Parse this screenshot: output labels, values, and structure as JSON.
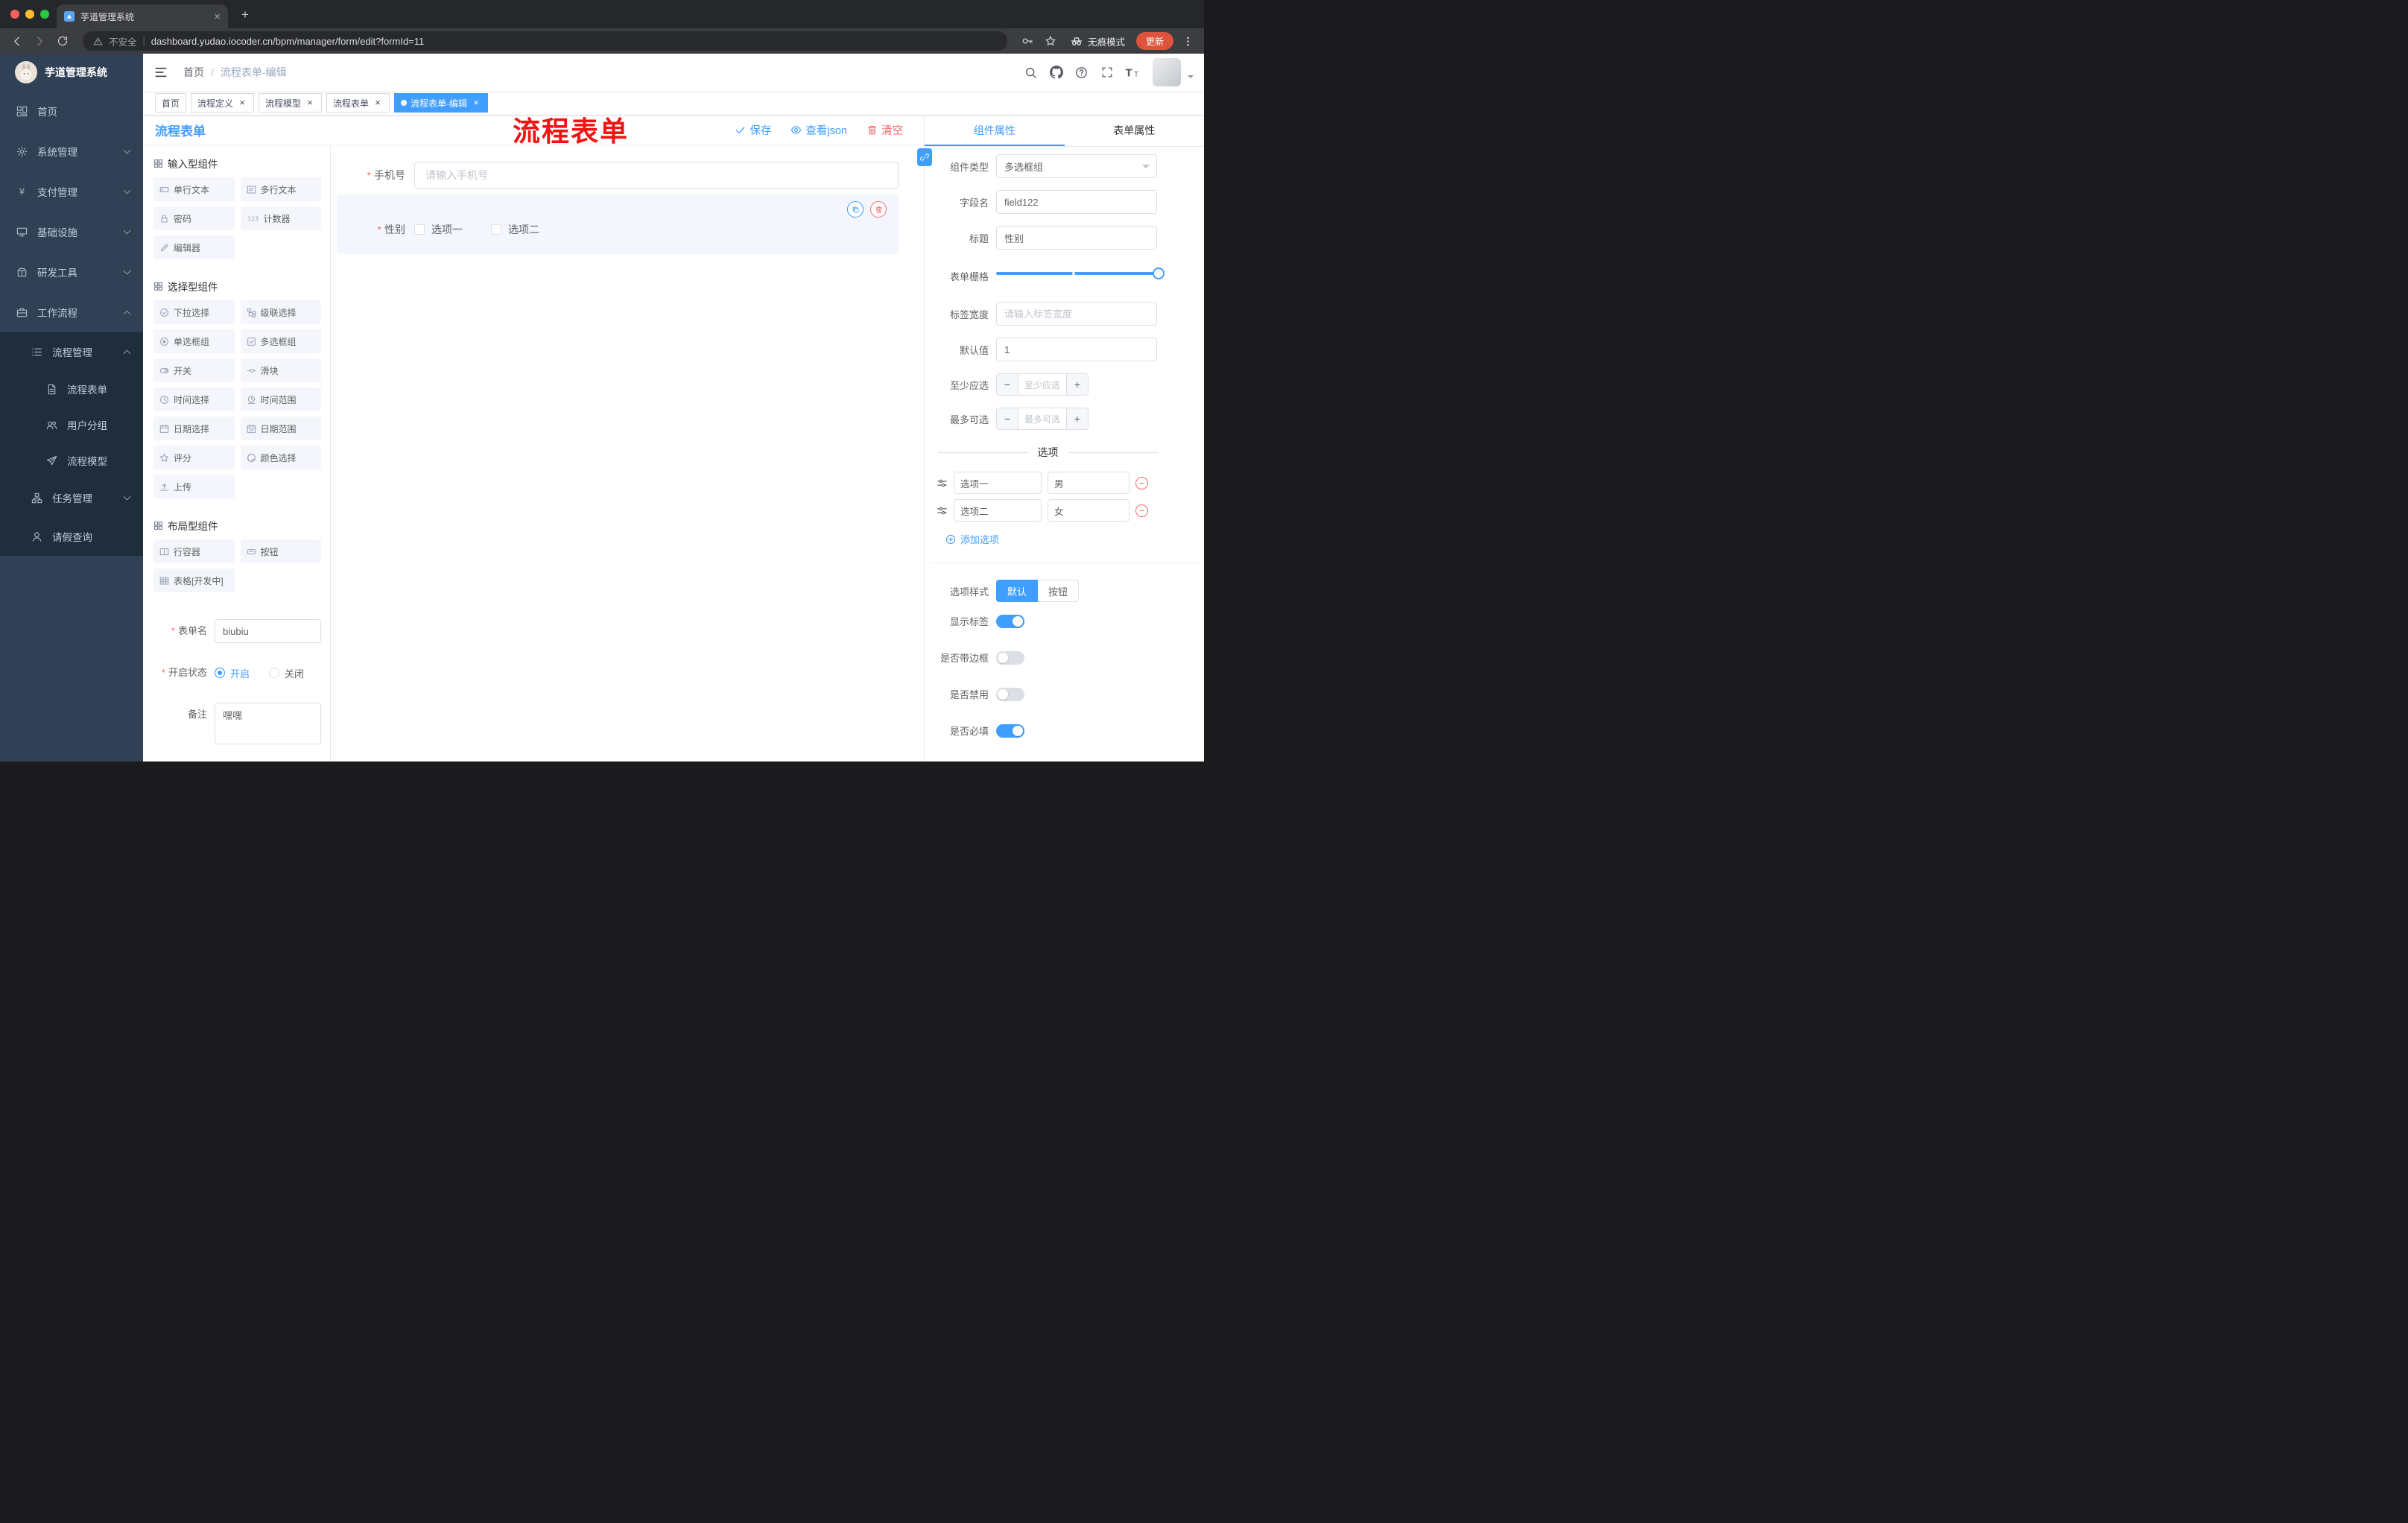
{
  "colors": {
    "accent": "#409eff",
    "danger": "#f56c6c",
    "sidebar": "#304156",
    "sidebar_sub": "#1f2d3d",
    "annotation": "#f21414",
    "update_pill": "#df523c"
  },
  "chrome": {
    "tab_title": "芋道管理系统",
    "security_label": "不安全",
    "url": "dashboard.yudao.iocoder.cn/bpm/manager/form/edit?formId=11",
    "incognito_label": "无痕模式",
    "update_label": "更新"
  },
  "annotation_text": "流程表单",
  "sidebar": {
    "logo_title": "芋道管理系统",
    "menu": [
      {
        "label": "首页",
        "icon": "dashboard"
      },
      {
        "label": "系统管理",
        "icon": "gear",
        "arrow": "down"
      },
      {
        "label": "支付管理",
        "icon": "yen",
        "arrow": "down"
      },
      {
        "label": "基础设施",
        "icon": "infra",
        "arrow": "down"
      },
      {
        "label": "研发工具",
        "icon": "tools",
        "arrow": "down"
      },
      {
        "label": "工作流程",
        "icon": "workflow",
        "arrow": "up"
      }
    ],
    "submenu": [
      {
        "label": "流程管理",
        "icon": "list",
        "arrow": "up",
        "level": 1
      },
      {
        "label": "流程表单",
        "icon": "doc",
        "level": 2
      },
      {
        "label": "用户分组",
        "icon": "users",
        "level": 2
      },
      {
        "label": "流程模型",
        "icon": "send",
        "level": 2
      },
      {
        "label": "任务管理",
        "icon": "tree",
        "arrow": "down",
        "level": 1
      },
      {
        "label": "请假查询",
        "icon": "user",
        "level": 1
      }
    ]
  },
  "header": {
    "breadcrumb": [
      "首页",
      "流程表单-编辑"
    ]
  },
  "tags": [
    {
      "label": "首页",
      "closable": false,
      "active": false
    },
    {
      "label": "流程定义",
      "closable": true,
      "active": false
    },
    {
      "label": "流程模型",
      "closable": true,
      "active": false
    },
    {
      "label": "流程表单",
      "closable": true,
      "active": false
    },
    {
      "label": "流程表单-编辑",
      "closable": true,
      "active": true
    }
  ],
  "designer": {
    "panel_title": "流程表单",
    "actions": {
      "save": "保存",
      "view_json": "查看json",
      "clear": "清空"
    },
    "palette": [
      {
        "title": "输入型组件",
        "items": [
          {
            "label": "单行文本",
            "icon": "input"
          },
          {
            "label": "多行文本",
            "icon": "textarea"
          },
          {
            "label": "密码",
            "icon": "password"
          },
          {
            "label": "计数器",
            "icon": "counter"
          },
          {
            "label": "编辑器",
            "icon": "editor"
          }
        ]
      },
      {
        "title": "选择型组件",
        "items": [
          {
            "label": "下拉选择",
            "icon": "select"
          },
          {
            "label": "级联选择",
            "icon": "cascader"
          },
          {
            "label": "单选框组",
            "icon": "radio"
          },
          {
            "label": "多选框组",
            "icon": "checkbox"
          },
          {
            "label": "开关",
            "icon": "switch"
          },
          {
            "label": "滑块",
            "icon": "slider"
          },
          {
            "label": "时间选择",
            "icon": "time"
          },
          {
            "label": "时间范围",
            "icon": "timerange"
          },
          {
            "label": "日期选择",
            "icon": "date"
          },
          {
            "label": "日期范围",
            "icon": "daterange"
          },
          {
            "label": "评分",
            "icon": "rate"
          },
          {
            "label": "颜色选择",
            "icon": "color"
          },
          {
            "label": "上传",
            "icon": "upload"
          }
        ]
      },
      {
        "title": "布局型组件",
        "items": [
          {
            "label": "行容器",
            "icon": "row"
          },
          {
            "label": "按钮",
            "icon": "button"
          },
          {
            "label": "表格[开发中]",
            "icon": "table"
          }
        ]
      }
    ],
    "meta": {
      "name_label": "表单名",
      "name_value": "biubiu",
      "status_label": "开启状态",
      "status_on": "开启",
      "status_off": "关闭",
      "remark_label": "备注",
      "remark_value": "嘿嘿"
    },
    "canvas": {
      "phone_label": "手机号",
      "phone_placeholder": "请输入手机号",
      "gender_label": "性别",
      "gender_options": [
        "选项一",
        "选项二"
      ]
    }
  },
  "props": {
    "tabs": [
      "组件属性",
      "表单属性"
    ],
    "type_label": "组件类型",
    "type_value": "多选框组",
    "field_label": "字段名",
    "field_value": "field122",
    "title_label": "标题",
    "title_value": "性别",
    "grid_label": "表单栅格",
    "width_label": "标签宽度",
    "width_placeholder": "请输入标签宽度",
    "default_label": "默认值",
    "default_value": "1",
    "min_label": "至少应选",
    "min_placeholder": "至少应选",
    "max_label": "最多可选",
    "max_placeholder": "最多可选",
    "options_title": "选项",
    "options": [
      {
        "label": "选项一",
        "value": "男"
      },
      {
        "label": "选项二",
        "value": "女"
      }
    ],
    "add_option": "添加选项",
    "style_label": "选项样式",
    "style_options": [
      "默认",
      "按钮"
    ],
    "toggles": [
      {
        "label": "显示标签",
        "on": true
      },
      {
        "label": "是否带边框",
        "on": false
      },
      {
        "label": "是否禁用",
        "on": false
      },
      {
        "label": "是否必填",
        "on": true
      }
    ]
  }
}
